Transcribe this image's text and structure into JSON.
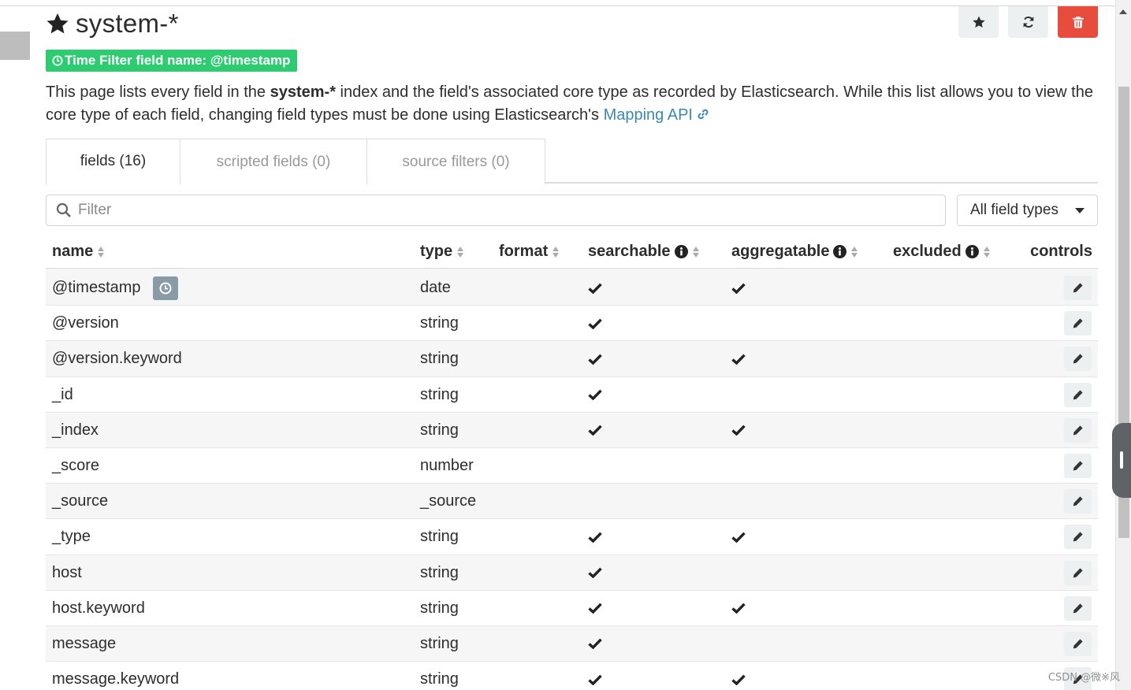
{
  "index": {
    "title": "system-*",
    "time_filter_badge": "Time Filter field name: @timestamp",
    "description": {
      "part1": "This page lists every field in the ",
      "index_name": "system-*",
      "part2": " index and the field's associated core type as recorded by Elasticsearch. While this list allows you to view the core type of each field, changing field types must be done using Elasticsearch's ",
      "link_text": "Mapping API"
    }
  },
  "actions": {
    "favorite": "star-icon",
    "refresh": "refresh-icon",
    "delete": "trash-icon"
  },
  "tabs": [
    {
      "label": "fields (16)",
      "active": true
    },
    {
      "label": "scripted fields (0)",
      "active": false
    },
    {
      "label": "source filters (0)",
      "active": false
    }
  ],
  "filter": {
    "placeholder": "Filter",
    "type_select": "All field types"
  },
  "table": {
    "headers": {
      "name": "name",
      "type": "type",
      "format": "format",
      "searchable": "searchable",
      "aggregatable": "aggregatable",
      "excluded": "excluded",
      "controls": "controls"
    },
    "rows": [
      {
        "name": "@timestamp",
        "type": "date",
        "searchable": true,
        "aggregatable": true,
        "time_field": true
      },
      {
        "name": "@version",
        "type": "string",
        "searchable": true,
        "aggregatable": false
      },
      {
        "name": "@version.keyword",
        "type": "string",
        "searchable": true,
        "aggregatable": true
      },
      {
        "name": "_id",
        "type": "string",
        "searchable": true,
        "aggregatable": false
      },
      {
        "name": "_index",
        "type": "string",
        "searchable": true,
        "aggregatable": true
      },
      {
        "name": "_score",
        "type": "number",
        "searchable": false,
        "aggregatable": false
      },
      {
        "name": "_source",
        "type": "_source",
        "searchable": false,
        "aggregatable": false
      },
      {
        "name": "_type",
        "type": "string",
        "searchable": true,
        "aggregatable": true
      },
      {
        "name": "host",
        "type": "string",
        "searchable": true,
        "aggregatable": false
      },
      {
        "name": "host.keyword",
        "type": "string",
        "searchable": true,
        "aggregatable": true
      },
      {
        "name": "message",
        "type": "string",
        "searchable": true,
        "aggregatable": false
      },
      {
        "name": "message.keyword",
        "type": "string",
        "searchable": true,
        "aggregatable": true
      }
    ]
  },
  "watermark": "CSDN @微※风",
  "colors": {
    "success": "#2ecc71",
    "danger": "#e74c3c",
    "link": "#3a89b4",
    "button_bg": "#ecf0f1"
  }
}
